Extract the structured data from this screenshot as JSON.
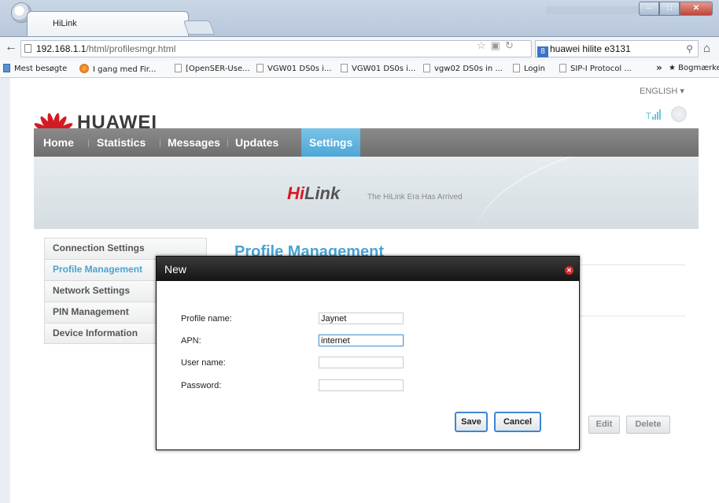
{
  "browser": {
    "tab_title": "HiLink",
    "url_host": "192.168.1.1",
    "url_path": "/html/profilesmgr.html",
    "search_value": "huawei hilite e3131",
    "bookmarks": [
      "Mest besøgte",
      "I gang med Fir...",
      "[OpenSER-Use...",
      "VGW01 DS0s i...",
      "VGW01 DS0s i...",
      "vgw02 DS0s in ...",
      "Login",
      "SIP-I Protocol ...",
      "Bogmærker"
    ]
  },
  "header": {
    "brand": "HUAWEI",
    "language": "ENGLISH ▾"
  },
  "nav": {
    "items": [
      "Home",
      "Statistics",
      "Messages",
      "Updates",
      "Settings"
    ],
    "active": "Settings"
  },
  "banner": {
    "logo_hi": "Hi",
    "logo_link": "Link",
    "tagline": "The HiLink Era Has Arrived"
  },
  "sidebar": {
    "items": [
      "Connection Settings",
      "Profile Management",
      "Network Settings",
      "PIN Management",
      "Device Information"
    ],
    "active": "Profile Management"
  },
  "content": {
    "title": "Profile Management",
    "buttons": {
      "edit": "Edit",
      "delete": "Delete"
    }
  },
  "dialog": {
    "title": "New",
    "fields": {
      "profile_name": {
        "label": "Profile name:",
        "value": "Jaynet"
      },
      "apn": {
        "label": "APN:",
        "value": "internet"
      },
      "user_name": {
        "label": "User name:",
        "value": ""
      },
      "password": {
        "label": "Password:",
        "value": ""
      }
    },
    "save_label": "Save",
    "cancel_label": "Cancel"
  },
  "colors": {
    "accent": "#4aa3d4",
    "brand_red": "#d51a21",
    "nav_bg": "#7a7a7a"
  }
}
